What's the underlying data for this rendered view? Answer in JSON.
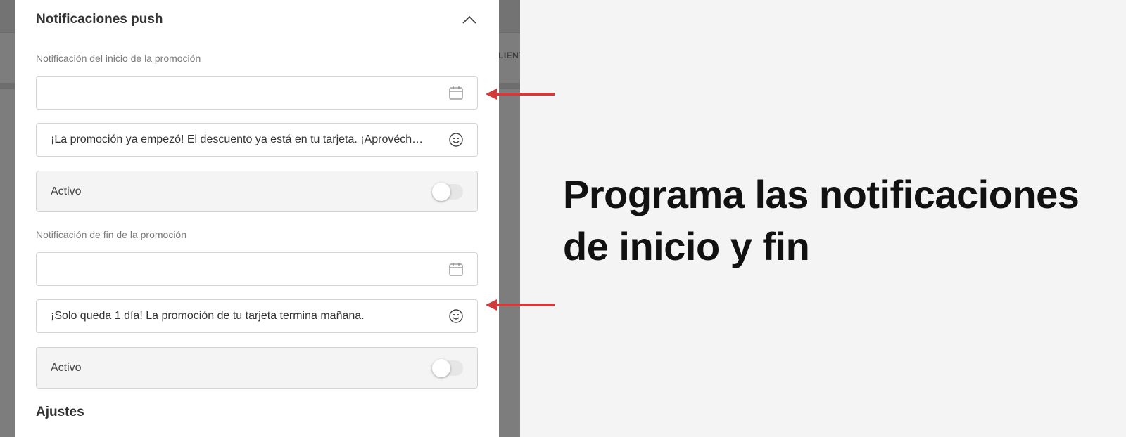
{
  "background_app": {
    "tab_fragment": "LIENT"
  },
  "panel": {
    "section_title": "Notificaciones push",
    "start": {
      "label": "Notificación del inicio de la promoción",
      "date_value": "",
      "message": "¡La promoción ya empezó! El descuento ya está en tu tarjeta. ¡Aprovéchalo!",
      "active_label": "Activo",
      "active": false
    },
    "end": {
      "label": "Notificación de fin de la promoción",
      "date_value": "",
      "message": "¡Solo queda 1 día! La promoción de tu tarjeta termina mañana.",
      "active_label": "Activo",
      "active": false
    },
    "settings_title": "Ajustes"
  },
  "annotation": {
    "headline_line1": "Programa las notificaciones",
    "headline_line2": "de inicio y fin",
    "arrow_color": "#d13b3b"
  },
  "icons": {
    "collapse": "chevron-up-icon",
    "date": "calendar-icon",
    "emoji": "smiley-icon"
  }
}
